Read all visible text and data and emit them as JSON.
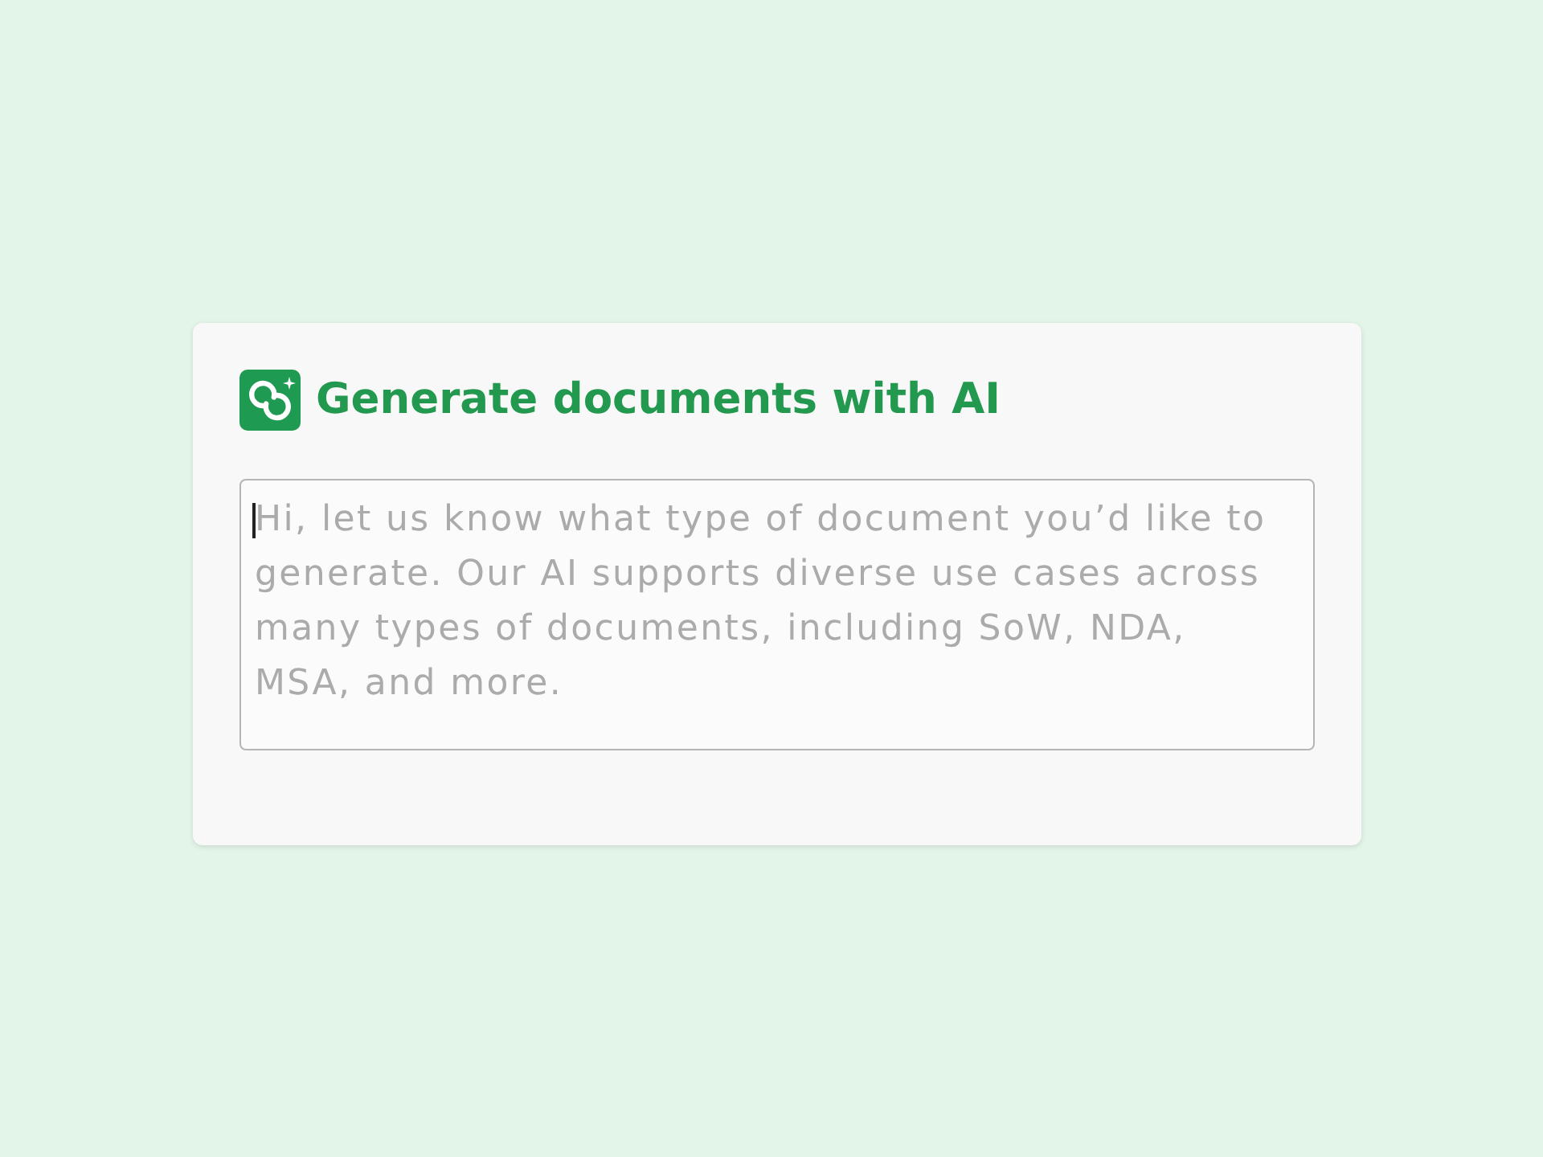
{
  "card": {
    "title": "Generate documents with AI",
    "prompt_field": {
      "placeholder": "Hi, let us know what type of document you’d like to generate. Our AI supports diverse use cases across many types of documents, including SoW, NDA, MSA, and more.",
      "focused": true
    }
  }
}
